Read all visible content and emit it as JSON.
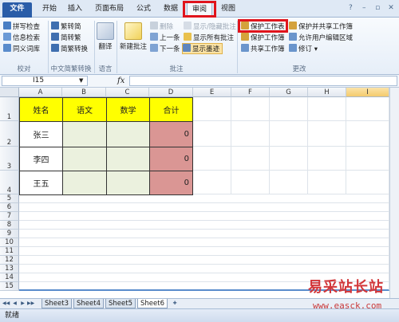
{
  "tabs": [
    "文件",
    "开始",
    "插入",
    "页面布局",
    "公式",
    "数据",
    "审阅",
    "视图"
  ],
  "window_controls": [
    "?",
    "–",
    "▫",
    "✕"
  ],
  "ribbon": {
    "groups": [
      "校对",
      "中文简繁转换",
      "语言",
      "批注",
      "更改"
    ],
    "proofing": [
      "拼写检查",
      "信息检索",
      "同义词库"
    ],
    "chinese": [
      "繁转简",
      "简转繁",
      "简繁转换"
    ],
    "language": "翻译",
    "comments": {
      "new": "新建批注",
      "delete": "删除",
      "previous": "上一条",
      "next": "下一条",
      "show_hide": "显示/隐藏批注",
      "show_all": "显示所有批注",
      "show_ink": "显示墨迹"
    },
    "changes": [
      "保护工作表",
      "保护工作簿",
      "共享工作簿",
      "保护并共享工作簿",
      "允许用户编辑区域",
      "修订"
    ]
  },
  "formula_bar": {
    "name_box": "I15",
    "fx": "fx",
    "value": ""
  },
  "columns": [
    "A",
    "B",
    "C",
    "D",
    "E",
    "F",
    "G",
    "H",
    "I"
  ],
  "rows": [
    "1",
    "2",
    "3",
    "4",
    "5",
    "6",
    "7",
    "8",
    "9",
    "10",
    "11",
    "12",
    "13",
    "14",
    "15"
  ],
  "table": {
    "headers": [
      "姓名",
      "语文",
      "数学",
      "合计"
    ],
    "rows": [
      {
        "name": "张三",
        "total": "0"
      },
      {
        "name": "李四",
        "total": "0"
      },
      {
        "name": "王五",
        "total": "0"
      }
    ]
  },
  "sheets": [
    "Sheet3",
    "Sheet4",
    "Sheet5",
    "Sheet6"
  ],
  "status": "就绪",
  "watermark": {
    "line1": "易采站长站",
    "line2": "www.easck.com"
  }
}
